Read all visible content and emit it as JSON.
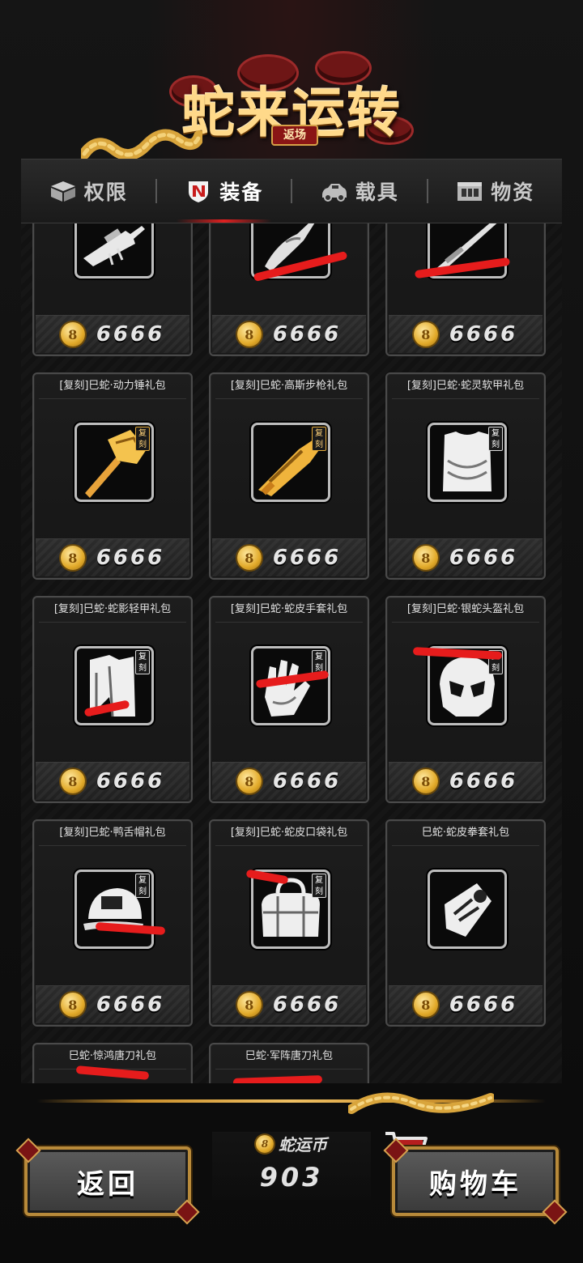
{
  "title": {
    "main": "蛇来运转",
    "sub": "返场"
  },
  "tabs": [
    {
      "label": "权限",
      "icon": "box-icon"
    },
    {
      "label": "装备",
      "icon": "armor-badge-icon",
      "active": true
    },
    {
      "label": "载具",
      "icon": "car-icon"
    },
    {
      "label": "物资",
      "icon": "crate-icon"
    }
  ],
  "items": [
    {
      "name": "",
      "price": "6666",
      "icon": "sniper-rifle-icon"
    },
    {
      "name": "",
      "price": "6666",
      "icon": "blade-weapon-icon"
    },
    {
      "name": "",
      "price": "6666",
      "icon": "rifle-icon"
    },
    {
      "name": "[复刻]巳蛇·动力锤礼包",
      "price": "6666",
      "icon": "power-hammer-icon",
      "badge": "复刻"
    },
    {
      "name": "[复刻]巳蛇·高斯步枪礼包",
      "price": "6666",
      "icon": "gauss-rifle-icon",
      "badge": "复刻"
    },
    {
      "name": "[复刻]巳蛇·蛇灵软甲礼包",
      "price": "6666",
      "icon": "soft-armor-icon",
      "badge": "复刻"
    },
    {
      "name": "[复刻]巳蛇·蛇影轻甲礼包",
      "price": "6666",
      "icon": "light-armor-icon",
      "badge": "复刻"
    },
    {
      "name": "[复刻]巳蛇·蛇皮手套礼包",
      "price": "6666",
      "icon": "gloves-icon",
      "badge": "复刻"
    },
    {
      "name": "[复刻]巳蛇·银蛇头盔礼包",
      "price": "6666",
      "icon": "helmet-icon",
      "badge": "复刻"
    },
    {
      "name": "[复刻]巳蛇·鸭舌帽礼包",
      "price": "6666",
      "icon": "cap-icon",
      "badge": "复刻"
    },
    {
      "name": "[复刻]巳蛇·蛇皮口袋礼包",
      "price": "6666",
      "icon": "bag-icon",
      "badge": "复刻"
    },
    {
      "name": "巳蛇·蛇皮拳套礼包",
      "price": "6666",
      "icon": "fist-wrap-icon"
    },
    {
      "name": "巳蛇·惊鸿唐刀礼包",
      "price": "",
      "icon": ""
    },
    {
      "name": "巳蛇·军阵唐刀礼包",
      "price": "",
      "icon": ""
    }
  ],
  "coin_symbol": "8",
  "currency": {
    "label": "蛇运币",
    "value": "903"
  },
  "buttons": {
    "back": "返回",
    "cart": "购物车"
  }
}
